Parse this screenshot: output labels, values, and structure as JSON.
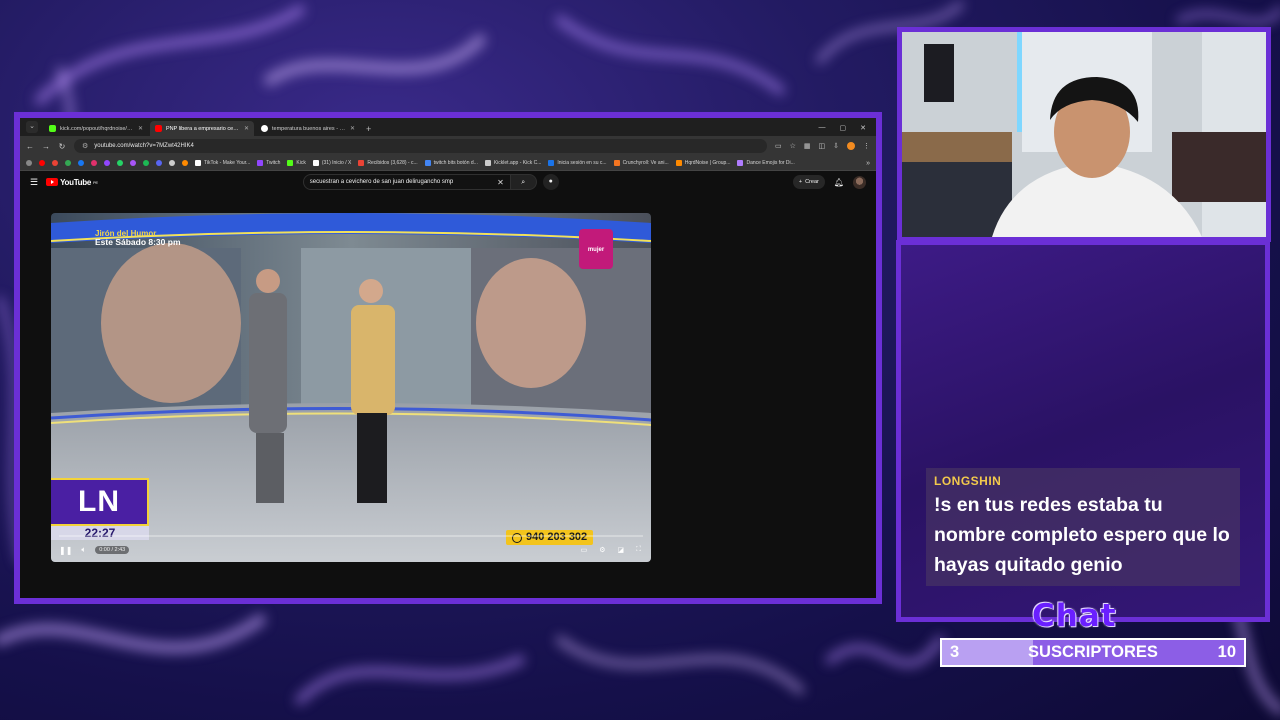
{
  "browser": {
    "tabs": [
      {
        "title": "kick.com/popout/hqrdnoise/ch...",
        "favicon_color": "#53fc18",
        "active": false
      },
      {
        "title": "PNP libera a empresario cevich...",
        "favicon_color": "#ff0000",
        "active": true
      },
      {
        "title": "temperatura buenos aires - Bu...",
        "favicon_color": "#ffffff",
        "active": false
      }
    ],
    "url": "youtube.com/watch?v=7MZwt42HIK4",
    "bookmarks": [
      {
        "label": "TikTok - Make Your...",
        "color": "#ffffff"
      },
      {
        "label": "Twitch",
        "color": "#9146ff"
      },
      {
        "label": "Kick",
        "color": "#53fc18"
      },
      {
        "label": "(31) Inicio / X",
        "color": "#ffffff"
      },
      {
        "label": "Recibidos (3,628) - c...",
        "color": "#ea4335"
      },
      {
        "label": "twitch bits botón d...",
        "color": "#4285f4"
      },
      {
        "label": "Kicklet.app - Kick C...",
        "color": "#cccccc"
      },
      {
        "label": "Inicia sesión en su c...",
        "color": "#1a73e8"
      },
      {
        "label": "Crunchyroll: Ve ani...",
        "color": "#f47521"
      },
      {
        "label": "HqrdNoise | Group...",
        "color": "#ff8a00"
      },
      {
        "label": "Dance Emojis for Di...",
        "color": "#b07cff"
      }
    ]
  },
  "youtube": {
    "logo": "YouTube",
    "country": "PE",
    "search_query": "secuestran a cevichero de san juan delirugancho smp",
    "create_label": "Crear"
  },
  "video": {
    "promo_line1": "Jirón del Humor",
    "promo_line2": "Este Sábado 8:30 pm",
    "channel_badge": "mujer",
    "logo": "LN",
    "clock": "22:27",
    "phone": "940 203 302",
    "time": "0:00 / 2:43",
    "progress_fraction": 0.0
  },
  "chat": {
    "username": "LONGSHIN",
    "message": "!s en tus redes estaba tu nombre completo espero que lo hayas quitado genio",
    "title": "Chat"
  },
  "subs_goal": {
    "current": "3",
    "label": "SUSCRIPTORES",
    "goal": "10",
    "progress_fraction": 0.3
  },
  "colors": {
    "frame": "#6b2fd6",
    "accent_yellow": "#f2c94c",
    "youtube_red": "#ff0000"
  }
}
